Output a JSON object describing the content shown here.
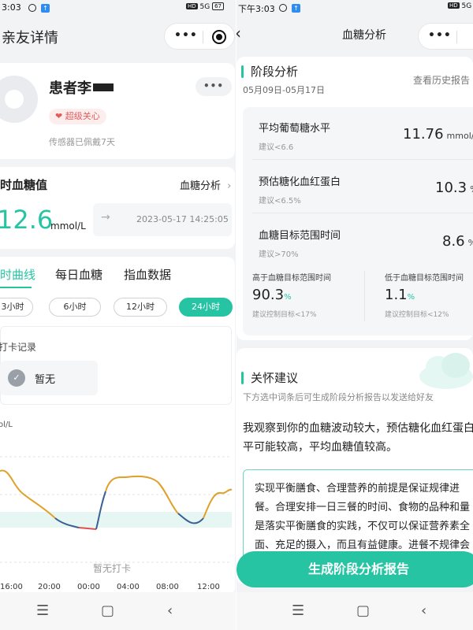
{
  "left": {
    "status": {
      "time": "3:03",
      "icons": "HD 5G 67"
    },
    "title": "亲友详情",
    "patient": {
      "name": "患者李",
      "tag": "超级关心",
      "sensor": "传感器已佩戴7天",
      "more": "•••"
    },
    "realtime": {
      "title": "时血糖值",
      "link": "血糖分析",
      "value": "12.6",
      "unit": "mmol/L",
      "timestamp": "2023-05-17 14:25:05"
    },
    "tabs": [
      "时曲线",
      "每日血糖",
      "指血数据"
    ],
    "ranges": [
      "3小时",
      "6小时",
      "12小时",
      "24小时"
    ],
    "checkin": {
      "title": "打卡记录",
      "empty": "暂无"
    },
    "chart_data": {
      "type": "line",
      "ylabel": "ol/L",
      "x_ticks": [
        "16:00",
        "20:00",
        "00:00",
        "04:00",
        "08:00",
        "12:00"
      ],
      "annotation": "暂无打卡",
      "target_band": "shaded",
      "series_colors": {
        "high": "#e0a02a",
        "normal": "#3a5f94",
        "low": "#e05050"
      }
    }
  },
  "right": {
    "status": {
      "time": "下午3:03",
      "icons": "HD 5G"
    },
    "title": "血糖分析",
    "stage": {
      "title": "阶段分析",
      "date_range": "05月09日-05月17日",
      "history_link": "查看历史报告"
    },
    "metrics": [
      {
        "label": "平均葡萄糖水平",
        "hint": "建议<6.6",
        "value": "11.76",
        "unit": "mmol/L"
      },
      {
        "label": "预估糖化血红蛋白",
        "hint": "建议<6.5%",
        "value": "10.3",
        "unit": "%"
      },
      {
        "label": "血糖目标范围时间",
        "hint": "建议>70%",
        "value": "8.6",
        "unit": "%"
      }
    ],
    "above": {
      "label": "高于血糖目标范围时间",
      "value": "90.3",
      "unit": "%",
      "hint": "建议控制目标<17%"
    },
    "below": {
      "label": "低于血糖目标范围时间",
      "value": "1.1",
      "unit": "%",
      "hint": "建议控制目标<12%"
    },
    "care": {
      "title": "关怀建议",
      "subtitle": "下方选中词条后可生成阶段分析报告以发送给好友",
      "text": "我观察到你的血糖波动较大，预估糖化血红蛋白平可能较高，平均血糖值较高。",
      "advice": "实现平衡膳食、合理营养的前提是保证规律进餐。合理安排一日三餐的时间、食物的品种和量是落实平衡膳食的实践，不仅可以保证营养素全面、充足的摄入，而且有益健康。进餐不规律会"
    },
    "generate_button": "生成阶段分析报告"
  },
  "nav": {
    "menu": "☰",
    "home": "▢",
    "back": "‹"
  }
}
